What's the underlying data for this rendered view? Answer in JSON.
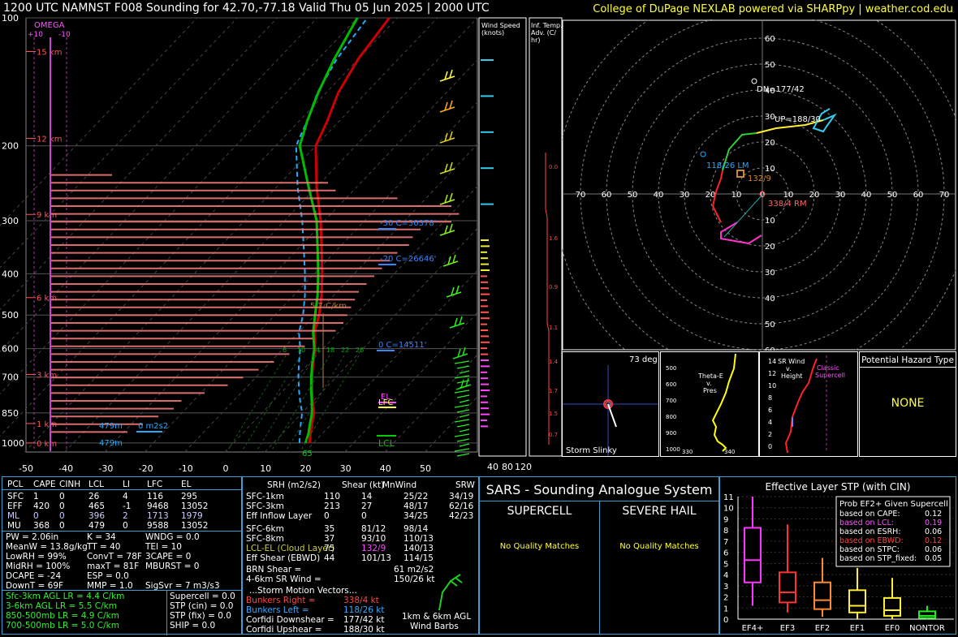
{
  "header": {
    "title": "1200 UTC NAMNST F008 Sounding for 42.70,-77.18 Valid  Thu 05 Jun 2025 | 2000 UTC",
    "credit": "College of DuPage NEXLAB powered via SHARPpy | weather.cod.edu"
  },
  "skewt": {
    "pressure_ticks": [
      "100",
      "200",
      "300",
      "400",
      "500",
      "600",
      "700",
      "850",
      "1000"
    ],
    "temp_ticks": [
      "-50",
      "-40",
      "-30",
      "-20",
      "-10",
      "0",
      "10",
      "20",
      "30",
      "40",
      "50"
    ],
    "omega_label": "OMEGA",
    "omega_plus": "+10",
    "omega_minus": "-10",
    "height_marks": [
      "15 km",
      "12 km",
      "9 km",
      "6 km",
      "3 km",
      "1 km",
      "0 km"
    ],
    "annotations": {
      "lapse": "5.7 C/km",
      "wb1": "-30 C=30378'",
      "wb2": "-20 C=26646'",
      "wb3": "0 C=14511'",
      "el": "EL",
      "lfc": "LFC",
      "lcl": "LCL",
      "srh_1km": "479m",
      "srh_val": "0 m2s2",
      "srh_2": "479m",
      "sfc_t": "65",
      "mix_ticks": [
        "6",
        "10",
        "14",
        "18",
        "22",
        "26"
      ]
    }
  },
  "side_labels": {
    "wind_speed": "Wind Speed (knots)",
    "inf_temp": "Inf. Temp. Adv. (C/hr)",
    "ws_ticks": [
      "40",
      "80",
      "120"
    ],
    "adv_ticks": [
      "0.0",
      "1.6",
      "0.9",
      "1.1",
      "1.4",
      "1.7",
      "1.5",
      "0.7"
    ]
  },
  "hodograph": {
    "rings": [
      "10",
      "20",
      "30",
      "40",
      "50",
      "60"
    ],
    "x_ticks": [
      "80",
      "70",
      "60",
      "50",
      "40",
      "30",
      "20",
      "10",
      "0",
      "10",
      "20",
      "30",
      "40",
      "50",
      "60",
      "70",
      "80"
    ],
    "labels": {
      "dn": "DN=177/42",
      "up": "UP=188/30",
      "lm": "118/26 LM",
      "mean": "132/9",
      "rm": "338/4 RM"
    }
  },
  "insets": {
    "slinky_deg": "73 deg",
    "slinky_label": "Storm Slinky",
    "thetae_label": [
      "Theta-E",
      "v.",
      "Pres"
    ],
    "thetae_y": [
      "500",
      "600",
      "700",
      "800",
      "900",
      "1000"
    ],
    "thetae_x": [
      "330",
      "340",
      "35"
    ],
    "srwind_label": [
      "SR Wind",
      "v.",
      "Height"
    ],
    "srwind_y": [
      "14",
      "12",
      "10",
      "8",
      "6",
      "4",
      "2",
      "0"
    ],
    "srwind_note": [
      "Classic",
      "Supercell"
    ],
    "hazard_title": "Potential Hazard Type",
    "hazard_value": "NONE"
  },
  "parcel_table": {
    "headers": [
      "PCL",
      "CAPE",
      "CINH",
      "LCL",
      "LI",
      "LFC",
      "EL"
    ],
    "rows": [
      [
        "SFC",
        "1",
        "0",
        "26",
        "4",
        "116",
        "295"
      ],
      [
        "EFF",
        "420",
        "0",
        "465",
        "-1",
        "9468",
        "13052"
      ],
      [
        "ML",
        "0",
        "0",
        "396",
        "2",
        "1713",
        "1979"
      ],
      [
        "MU",
        "368",
        "0",
        "479",
        "0",
        "9588",
        "13052"
      ]
    ],
    "indices": [
      [
        "PW = 2.06in",
        "K = 34",
        "WNDG = 0.0"
      ],
      [
        "MeanW = 13.8g/kg",
        "TT = 40",
        "TEI = 10"
      ],
      [
        "LowRH = 99%",
        "ConvT = 78F",
        "3CAPE = 0"
      ],
      [
        "MidRH = 100%",
        "maxT = 81F",
        "MBURST = 0"
      ],
      [
        "DCAPE = -24",
        "ESP = 0.0",
        ""
      ],
      [
        "DownT = 69F",
        "MMP = 1.0",
        "SigSvr = 7 m3/s3"
      ]
    ],
    "lapse": [
      "Sfc-3km AGL LR = 4.4 C/km",
      "3-6km AGL LR = 5.5 C/km",
      "850-500mb LR = 4.9 C/km",
      "700-500mb LR = 5.0 C/km"
    ],
    "composite": [
      "Supercell = 0.0",
      "STP (cin) = 0.0",
      "STP (fix) = 0.0",
      "SHIP = 0.0"
    ]
  },
  "kinematics": {
    "headers": [
      "SRH (m2/s2)",
      "Shear (kt)",
      "MnWind",
      "SRW"
    ],
    "rows": [
      [
        "SFC-1km",
        "110",
        "14",
        "25/22",
        "34/19"
      ],
      [
        "SFC-3km",
        "213",
        "27",
        "48/17",
        "62/16"
      ],
      [
        "Eff Inflow Layer",
        "0",
        "0",
        "34/25",
        "42/23"
      ],
      [
        "SFC-6km",
        "35",
        "81/12",
        "98/14",
        ""
      ],
      [
        "SFC-8km",
        "37",
        "93/10",
        "110/13",
        ""
      ],
      [
        "LCL-EL (Cloud Layer)",
        "75",
        "132/9",
        "140/13",
        ""
      ],
      [
        "Eff Shear (EBWD)",
        "44",
        "101/13",
        "114/15",
        ""
      ]
    ],
    "brn": [
      "BRN Shear =",
      "61 m2/s2"
    ],
    "srw46": [
      "4-6km SR Wind =",
      "150/26 kt"
    ],
    "storm_motion": "...Storm Motion Vectors...",
    "motions": [
      [
        "Bunkers Right =",
        "338/4 kt"
      ],
      [
        "Bunkers Left =",
        "118/26 kt"
      ],
      [
        "Corfidi Downshear =",
        "177/42 kt"
      ],
      [
        "Corfidi Upshear =",
        "188/30 kt"
      ]
    ],
    "barbs_label": [
      "1km & 6km AGL",
      "Wind Barbs"
    ]
  },
  "sars": {
    "title": "SARS - Sounding Analogue System",
    "supercell": "SUPERCELL",
    "hail": "SEVERE HAIL",
    "sc_match": "No Quality Matches",
    "hail_match": "No Quality Matches"
  },
  "stp": {
    "title": "Effective Layer STP (with CIN)",
    "y_ticks": [
      "11",
      "10",
      "9",
      "8",
      "7",
      "6",
      "5",
      "4",
      "3",
      "2",
      "1",
      "0"
    ],
    "categories": [
      "EF4+",
      "EF3",
      "EF2",
      "EF1",
      "EF0",
      "NONTOR"
    ],
    "prob_title": "Prob EF2+ Given Supercell",
    "probs": [
      [
        "based on CAPE:",
        "0.12"
      ],
      [
        "based on LCL:",
        "0.19"
      ],
      [
        "based on ESRH:",
        "0.06"
      ],
      [
        "based on EBWD:",
        "0.12"
      ],
      [
        "based on STPC:",
        "0.06"
      ],
      [
        "based on STP_fixed:",
        "0.05"
      ]
    ]
  },
  "colors": {
    "temp": "#cc0000",
    "dewpoint": "#00bb00",
    "wetbulb": "#22aaff",
    "accent_border": "#3aa0d0",
    "hazard": "#ffff33"
  },
  "chart_data": {
    "type": "line",
    "title": "1200 UTC NAMNST F008 Sounding for 42.70,-77.18 Valid  Thu 05 Jun 2025 | 2000 UTC",
    "xlabel": "",
    "ylabel": "",
    "ylim": [
      1000,
      100
    ],
    "xlim": [
      -50,
      50
    ],
    "pressure": [
      1000,
      950,
      900,
      850,
      800,
      750,
      700,
      650,
      600,
      550,
      500,
      450,
      400,
      350,
      300,
      250,
      200,
      175,
      150,
      125,
      100
    ],
    "series": [
      {
        "name": "",
        "values": [
          19,
          17,
          15,
          13,
          10,
          7,
          4,
          1,
          -2,
          -6,
          -9,
          -13,
          -18,
          -24,
          -31,
          -40,
          -50,
          -53,
          -57,
          -60,
          -62
        ]
      },
      {
        "name": "",
        "values": [
          18,
          16.5,
          14.5,
          12.5,
          9.8,
          6.8,
          3.8,
          0.8,
          -2.2,
          -6.3,
          -10,
          -14,
          -19,
          -25,
          -32,
          -42,
          -54,
          -58,
          -62,
          -66,
          -70
        ]
      }
    ],
    "stp_boxes": [
      {
        "category": "EF4+",
        "whisker_low": 1.2,
        "q1": 3.3,
        "median": 5.3,
        "q3": 8.2,
        "whisker_high": 11.0
      },
      {
        "category": "EF3",
        "whisker_low": 0.6,
        "q1": 1.5,
        "median": 2.4,
        "q3": 4.2,
        "whisker_high": 8.5
      },
      {
        "category": "EF2",
        "whisker_low": 0.2,
        "q1": 0.9,
        "median": 1.7,
        "q3": 3.3,
        "whisker_high": 5.5
      },
      {
        "category": "EF1",
        "whisker_low": 0.0,
        "q1": 0.6,
        "median": 1.2,
        "q3": 2.6,
        "whisker_high": 4.6
      },
      {
        "category": "EF0",
        "whisker_low": 0.0,
        "q1": 0.3,
        "median": 0.8,
        "q3": 1.9,
        "whisker_high": 3.7
      },
      {
        "category": "NONTOR",
        "whisker_low": 0.0,
        "q1": 0.1,
        "median": 0.3,
        "q3": 0.7,
        "whisker_high": 1.2
      }
    ]
  }
}
